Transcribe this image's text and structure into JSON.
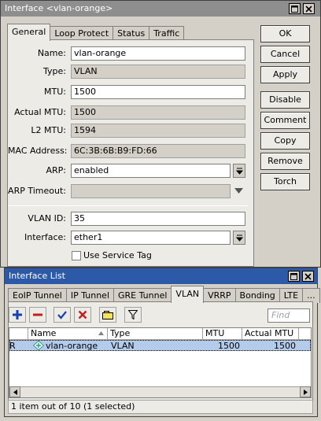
{
  "window": {
    "title": "Interface <vlan-orange>"
  },
  "tabs": [
    "General",
    "Loop Protect",
    "Status",
    "Traffic"
  ],
  "fields": {
    "name_label": "Name:",
    "name_value": "vlan-orange",
    "type_label": "Type:",
    "type_value": "VLAN",
    "mtu_label": "MTU:",
    "mtu_value": "1500",
    "actual_mtu_label": "Actual MTU:",
    "actual_mtu_value": "1500",
    "l2_mtu_label": "L2 MTU:",
    "l2_mtu_value": "1594",
    "mac_label": "MAC Address:",
    "mac_value": "6C:3B:6B:B9:FD:66",
    "arp_label": "ARP:",
    "arp_value": "enabled",
    "arp_timeout_label": "ARP Timeout:",
    "arp_timeout_value": "",
    "vlan_id_label": "VLAN ID:",
    "vlan_id_value": "35",
    "interface_label": "Interface:",
    "interface_value": "ether1",
    "service_tag_label": "Use Service Tag"
  },
  "buttons": [
    "OK",
    "Cancel",
    "Apply",
    "Disable",
    "Comment",
    "Copy",
    "Remove",
    "Torch"
  ],
  "list_window": {
    "title": "Interface List",
    "tabs": [
      "EoIP Tunnel",
      "IP Tunnel",
      "GRE Tunnel",
      "VLAN",
      "VRRP",
      "Bonding",
      "LTE",
      "..."
    ],
    "active_tab": "VLAN",
    "find_placeholder": "Find",
    "columns": [
      "Name",
      "Type",
      "MTU",
      "Actual MTU"
    ],
    "rows": [
      {
        "flag": "R",
        "name": "vlan-orange",
        "type": "VLAN",
        "mtu": "1500",
        "actual_mtu": "1500"
      }
    ],
    "status": "1 item out of 10 (1 selected)"
  },
  "colors": {
    "titlebar": "#8e8e8e",
    "selected_row": "#b4ccec",
    "add": "#1a3fb0",
    "remove": "#c02020"
  },
  "icons": [
    "minimize-icon",
    "close-icon",
    "add-icon",
    "remove-icon",
    "enable-icon",
    "disable-icon",
    "comment-icon",
    "filter-icon",
    "sort-arrow-icon",
    "dropdown-arrow-icon",
    "dropdown-arrow-icon",
    "vlan-interface-icon",
    "scroll-left-icon",
    "scroll-right-icon"
  ]
}
